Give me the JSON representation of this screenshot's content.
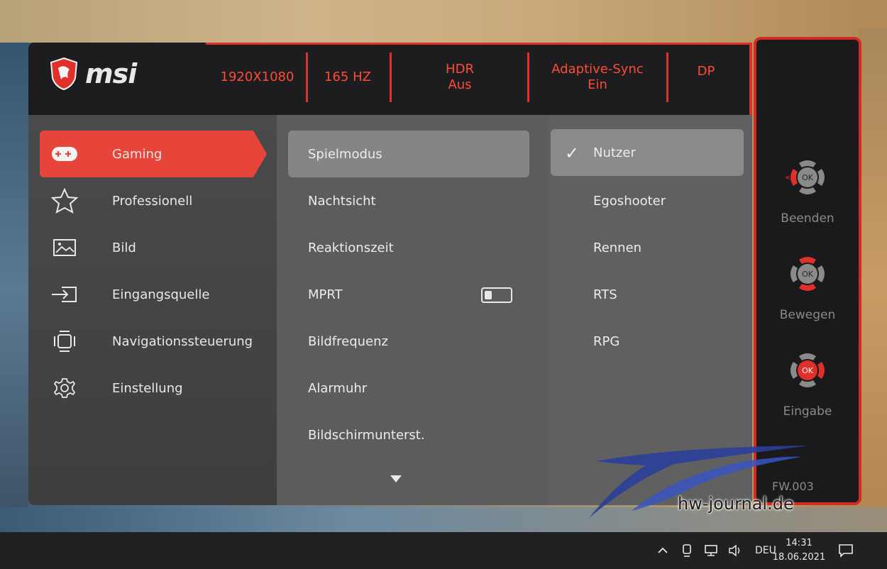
{
  "header": {
    "logo_text": "msi",
    "items": [
      {
        "line1": "1920X1080",
        "line2": ""
      },
      {
        "line1": "165 HZ",
        "line2": ""
      },
      {
        "line1": "HDR",
        "line2": "Aus"
      },
      {
        "line1": "Adaptive-Sync",
        "line2": "Ein"
      },
      {
        "line1": "DP",
        "line2": ""
      }
    ]
  },
  "menu": {
    "items": [
      {
        "label": "Gaming",
        "icon": "gamepad-icon",
        "active": true
      },
      {
        "label": "Professionell",
        "icon": "star-icon",
        "active": false
      },
      {
        "label": "Bild",
        "icon": "image-icon",
        "active": false
      },
      {
        "label": "Eingangsquelle",
        "icon": "input-source-icon",
        "active": false
      },
      {
        "label": "Navigationssteuerung",
        "icon": "navigation-icon",
        "active": false
      },
      {
        "label": "Einstellung",
        "icon": "gear-icon",
        "active": false
      }
    ]
  },
  "submenu": {
    "items": [
      {
        "label": "Spielmodus",
        "active": true
      },
      {
        "label": "Nachtsicht",
        "active": false
      },
      {
        "label": "Reaktionszeit",
        "active": false
      },
      {
        "label": "MPRT",
        "active": false,
        "toggle": "off"
      },
      {
        "label": "Bildfrequenz",
        "active": false
      },
      {
        "label": "Alarmuhr",
        "active": false
      },
      {
        "label": "Bildschirmunterst.",
        "active": false
      }
    ]
  },
  "options": {
    "items": [
      {
        "label": "Nutzer",
        "selected": true
      },
      {
        "label": "Egoshooter",
        "selected": false
      },
      {
        "label": "Rennen",
        "selected": false
      },
      {
        "label": "RTS",
        "selected": false
      },
      {
        "label": "RPG",
        "selected": false
      }
    ]
  },
  "side_nav": {
    "groups": [
      {
        "label": "Beenden",
        "center": "OK",
        "highlight": "left"
      },
      {
        "label": "Bewegen",
        "center": "OK",
        "highlight": "updown"
      },
      {
        "label": "Eingabe",
        "center": "OK",
        "highlight": "center-right"
      }
    ],
    "firmware": "FW.003"
  },
  "watermark": "hw-journal.de",
  "taskbar": {
    "language": "DEU",
    "time": "14:31",
    "date": "18.06.2021"
  },
  "colors": {
    "accent": "#e0302a",
    "header_text": "#ff4a3a",
    "active_menu": "#e8453a"
  }
}
